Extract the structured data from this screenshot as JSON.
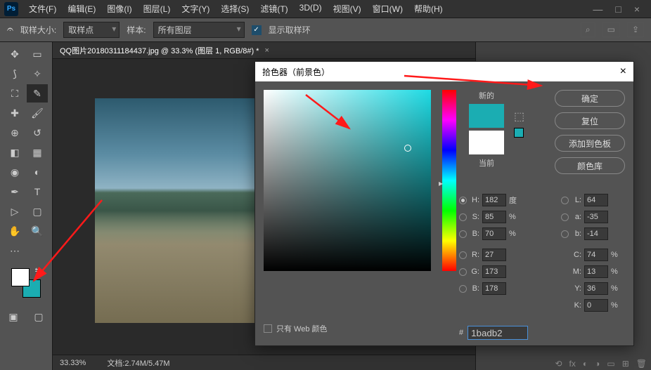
{
  "menu": {
    "items": [
      "文件(F)",
      "编辑(E)",
      "图像(I)",
      "图层(L)",
      "文字(Y)",
      "选择(S)",
      "滤镜(T)",
      "3D(D)",
      "视图(V)",
      "窗口(W)",
      "帮助(H)"
    ]
  },
  "optbar": {
    "sample_size_label": "取样大小:",
    "sample_size_value": "取样点",
    "sample_label": "样本:",
    "sample_value": "所有图层",
    "show_ring": "显示取样环"
  },
  "doctab": {
    "title": "QQ图片20180311184437.jpg @ 33.3% (图层 1, RGB/8#) *"
  },
  "dialog": {
    "title": "拾色器（前景色）",
    "btn_ok": "确定",
    "btn_cancel": "复位",
    "btn_add": "添加到色板",
    "btn_lib": "颜色库",
    "new_label": "新的",
    "current_label": "当前",
    "web_only": "只有 Web 颜色",
    "hex": "1badb2",
    "H": "182",
    "H_unit": "度",
    "S": "85",
    "S_unit": "%",
    "Bv": "70",
    "Bv_unit": "%",
    "R": "27",
    "G": "173",
    "Bc": "178",
    "L": "64",
    "a": "-35",
    "b": "-14",
    "C": "74",
    "M": "13",
    "Y": "36",
    "K": "0",
    "pct": "%"
  },
  "status": {
    "zoom": "33.33%",
    "doc": "文档:2.74M/5.47M"
  },
  "colors": {
    "new": "#1badb2",
    "current": "#ffffff",
    "fg": "#ffffff",
    "bg": "#1badb2"
  }
}
